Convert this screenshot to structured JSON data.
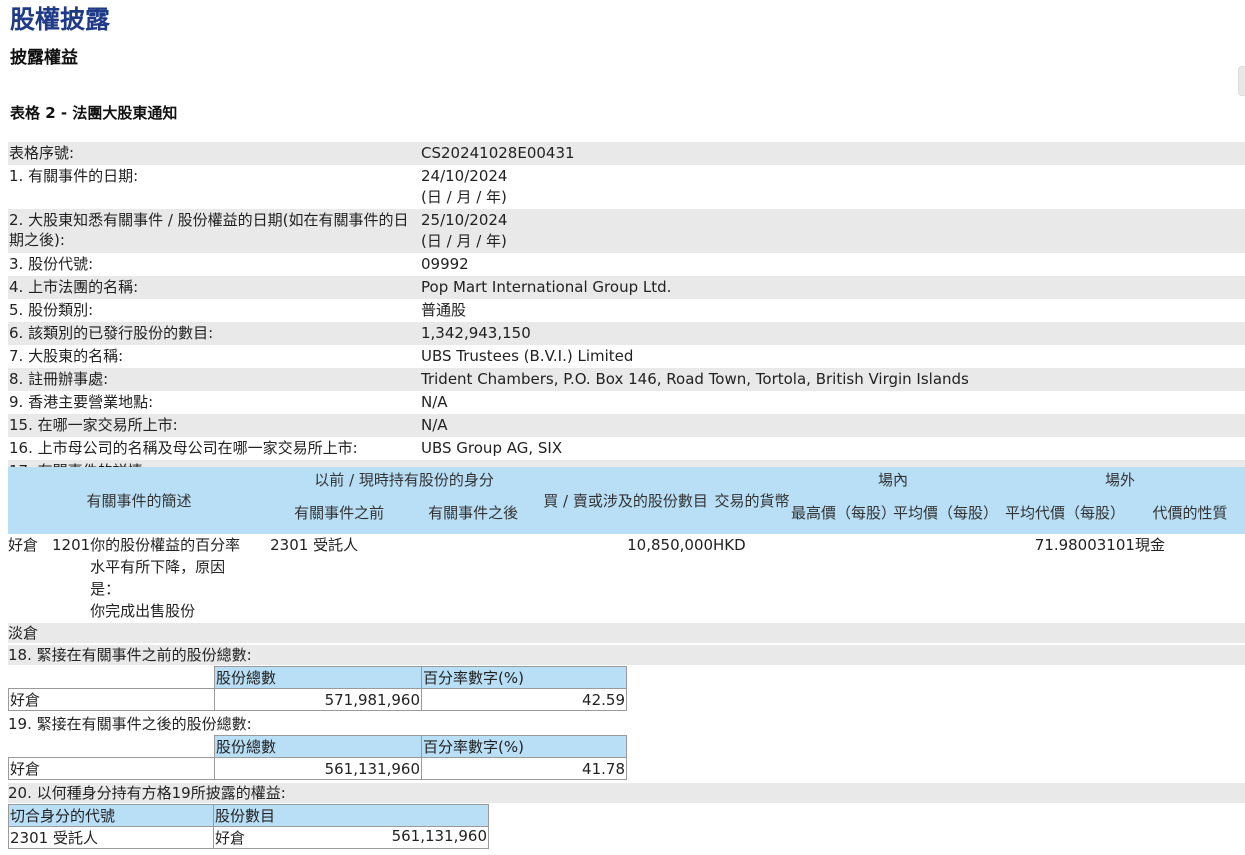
{
  "header": {
    "title": "股權披露",
    "subtitle": "披露權益",
    "form_name": "表格 2 - 法團大股東通知"
  },
  "fields": [
    {
      "label": "表格序號:",
      "value": [
        "CS20241028E00431"
      ]
    },
    {
      "label": "1. 有關事件的日期:",
      "value": [
        "24/10/2024",
        "(日 / 月 / 年)"
      ]
    },
    {
      "label": "2. 大股東知悉有關事件 / 股份權益的日期(如在有關事件的日期之後):",
      "value": [
        "25/10/2024",
        "(日 / 月 / 年)"
      ]
    },
    {
      "label": "3. 股份代號:",
      "value": [
        "09992"
      ]
    },
    {
      "label": "4. 上市法團的名稱:",
      "value": [
        "Pop Mart International Group Ltd."
      ]
    },
    {
      "label": "5. 股份類別:",
      "value": [
        "普通股"
      ]
    },
    {
      "label": "6. 該類別的已發行股份的數目:",
      "value": [
        "1,342,943,150"
      ]
    },
    {
      "label": "7. 大股東的名稱:",
      "value": [
        "UBS Trustees (B.V.I.) Limited"
      ]
    },
    {
      "label": "8. 註冊辦事處:",
      "value": [
        "Trident Chambers, P.O. Box 146, Road Town, Tortola, British Virgin Islands"
      ]
    },
    {
      "label": "9. 香港主要營業地點:",
      "value": [
        "N/A"
      ]
    },
    {
      "label": "15. 在哪一家交易所上市:",
      "value": [
        "N/A"
      ]
    },
    {
      "label": "16. 上市母公司的名稱及母公司在哪一家交易所上市:",
      "value": [
        "UBS Group AG, SIX"
      ]
    },
    {
      "label": "17. 有關事件的詳情:",
      "value": [
        ""
      ]
    }
  ],
  "event_table": {
    "h_desc": "有關事件的簡述",
    "h_capacity": "以前 / 現時持有股份的身分",
    "h_before": "有關事件之前",
    "h_after": "有關事件之後",
    "h_shares": "買 / 賣或涉及的股份數目",
    "h_currency": "交易的貨幣",
    "h_onexchange": "場內",
    "h_high": "最高價（每股）",
    "h_avg": "平均價（每股）",
    "h_offexchange": "場外",
    "h_avg_consid": "平均代價（每股）",
    "h_nature": "代價的性質",
    "row": {
      "position": "好倉",
      "code": "1201",
      "desc": [
        "你的股份權益的百分率",
        "水平有所下降，原因",
        "是：",
        "你完成出售股份"
      ],
      "before": "2301 受託人",
      "after": "",
      "shares": "10,850,000",
      "currency": "HKD",
      "high": "",
      "avg": "",
      "avg_consid": "71.98003101",
      "nature": "現金"
    },
    "short_label": "淡倉"
  },
  "section18": {
    "label": "18. 緊接在有關事件之前的股份總數:",
    "h_total": "股份總數",
    "h_pct": "百分率數字(%)",
    "row_label": "好倉",
    "total": "571,981,960",
    "pct": "42.59"
  },
  "section19": {
    "label": "19. 緊接在有關事件之後的股份總數:",
    "h_total": "股份總數",
    "h_pct": "百分率數字(%)",
    "row_label": "好倉",
    "total": "561,131,960",
    "pct": "41.78"
  },
  "section20": {
    "label": "20. 以何種身分持有方格19所披露的權益:",
    "h_code": "切合身分的代號",
    "h_number": "股份數目",
    "code": "2301 受託人",
    "position": "好倉",
    "number": "561,131,960"
  }
}
